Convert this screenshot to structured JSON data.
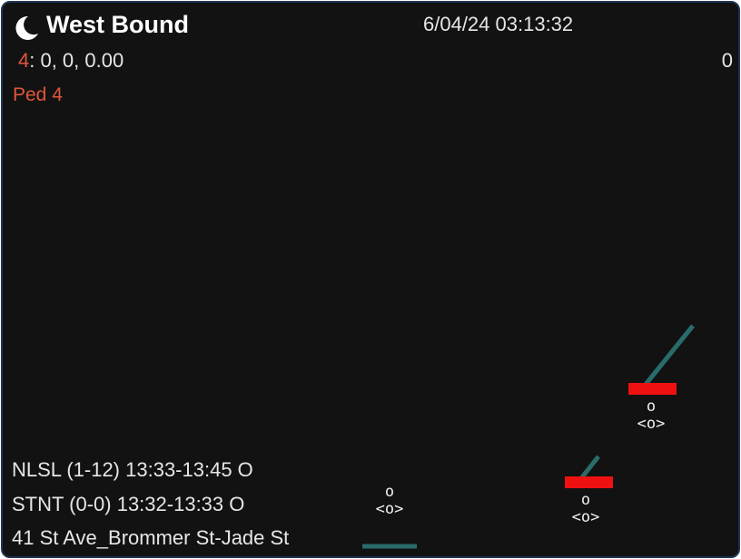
{
  "header": {
    "icon": "moon-icon",
    "title": "West Bound",
    "datetime": "6/04/24 03:13:32"
  },
  "readout": {
    "index": "4",
    "values": ": 0, 0, 0.00",
    "count": "0"
  },
  "ped_label": "Ped 4",
  "info_lines": [
    "NLSL (1-12) 13:33-13:45 O",
    "STNT (0-0) 13:32-13:33 O",
    "41 St Ave_Brommer St-Jade St"
  ],
  "detectors": [
    {
      "state": "o",
      "label": "<o>"
    },
    {
      "state": "o",
      "label": "<o>"
    },
    {
      "state": "o",
      "label": "<o>"
    }
  ],
  "colors": {
    "background": "#121212",
    "accent_red": "#e2563a",
    "detector_bar": "#ef1111",
    "lane_line": "#2a6b6b",
    "frame_border": "#1d3552"
  }
}
